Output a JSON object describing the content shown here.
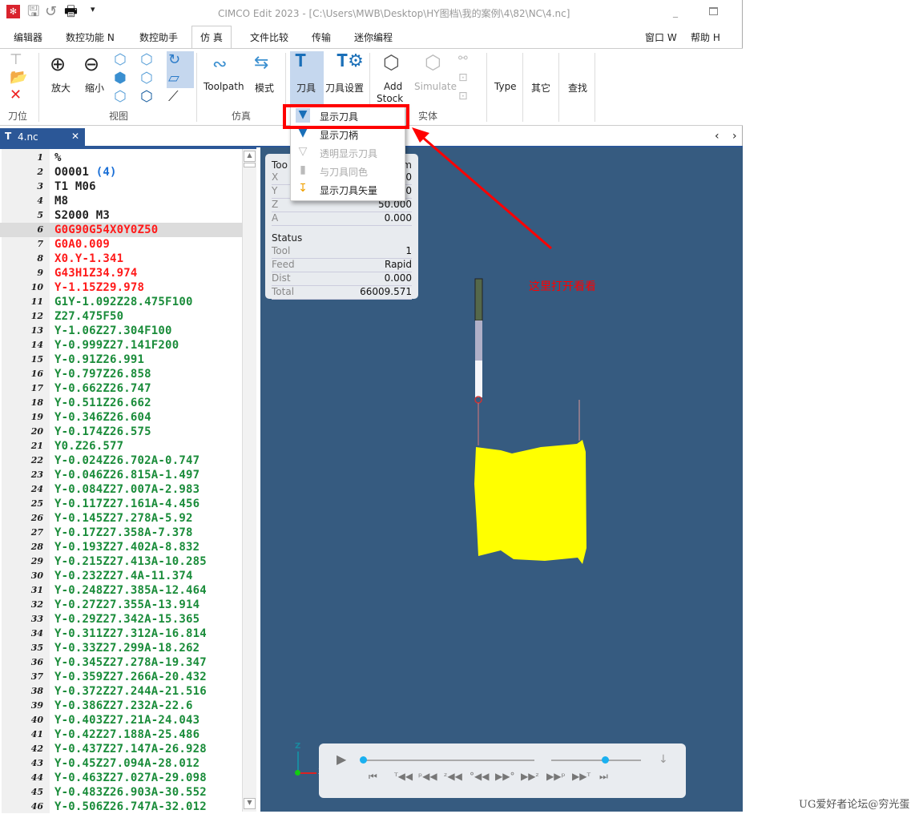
{
  "title": "CIMCO Edit 2023 - [C:\\Users\\MWB\\Desktop\\HY图档\\我的案例\\4\\82\\NC\\4.nc]",
  "menu_tabs": [
    "编辑器",
    "数控功能 N",
    "数控助手",
    "仿 真",
    "文件比较",
    "传输",
    "迷你编程"
  ],
  "menu_right": [
    "窗口 W",
    "帮助 H"
  ],
  "ribbon": {
    "groups": [
      "刀位",
      "视图",
      "仿真",
      "实体"
    ],
    "buttons": {
      "zoom_in": "放大",
      "zoom_out": "缩小",
      "toolpath": "Toolpath",
      "mode": "模式",
      "tool": "刀具",
      "tool_settings": "刀具设置",
      "add_stock_1": "Add",
      "add_stock_2": "Stock",
      "simulate": "Simulate",
      "type": "Type",
      "other": "其它",
      "find": "查找"
    }
  },
  "dropdown": {
    "items": [
      {
        "label": "显示刀具",
        "enabled": true,
        "selected": true
      },
      {
        "label": "显示刀柄",
        "enabled": true
      },
      {
        "label": "透明显示刀具",
        "enabled": false
      },
      {
        "label": "与刀具同色",
        "enabled": false
      },
      {
        "label": "显示刀具矢量",
        "enabled": true
      }
    ]
  },
  "doc_tab": {
    "label": "4.nc"
  },
  "code": [
    {
      "t": "%",
      "c": "black"
    },
    {
      "t": "O0001 ",
      "c": "black",
      "extra": "(4)"
    },
    {
      "t": "T1 M06",
      "c": "black"
    },
    {
      "t": "M8",
      "c": "black"
    },
    {
      "t": "S2000 M3",
      "c": "black"
    },
    {
      "t": "G0G90G54X0Y0Z50",
      "c": "red"
    },
    {
      "t": "G0A0.009",
      "c": "red"
    },
    {
      "t": "X0.Y-1.341",
      "c": "red"
    },
    {
      "t": "G43H1Z34.974",
      "c": "red"
    },
    {
      "t": "Y-1.15Z29.978",
      "c": "red"
    },
    {
      "t": "G1Y-1.092Z28.475F100",
      "c": "green"
    },
    {
      "t": "Z27.475F50",
      "c": "green"
    },
    {
      "t": "Y-1.06Z27.304F100",
      "c": "green"
    },
    {
      "t": "Y-0.999Z27.141F200",
      "c": "green"
    },
    {
      "t": "Y-0.91Z26.991",
      "c": "green"
    },
    {
      "t": "Y-0.797Z26.858",
      "c": "green"
    },
    {
      "t": "Y-0.662Z26.747",
      "c": "green"
    },
    {
      "t": "Y-0.511Z26.662",
      "c": "green"
    },
    {
      "t": "Y-0.346Z26.604",
      "c": "green"
    },
    {
      "t": "Y-0.174Z26.575",
      "c": "green"
    },
    {
      "t": "Y0.Z26.577",
      "c": "green"
    },
    {
      "t": "Y-0.024Z26.702A-0.747",
      "c": "green"
    },
    {
      "t": "Y-0.046Z26.815A-1.497",
      "c": "green"
    },
    {
      "t": "Y-0.084Z27.007A-2.983",
      "c": "green"
    },
    {
      "t": "Y-0.117Z27.161A-4.456",
      "c": "green"
    },
    {
      "t": "Y-0.145Z27.278A-5.92",
      "c": "green"
    },
    {
      "t": "Y-0.17Z27.358A-7.378",
      "c": "green"
    },
    {
      "t": "Y-0.193Z27.402A-8.832",
      "c": "green"
    },
    {
      "t": "Y-0.215Z27.413A-10.285",
      "c": "green"
    },
    {
      "t": "Y-0.232Z27.4A-11.374",
      "c": "green"
    },
    {
      "t": "Y-0.248Z27.385A-12.464",
      "c": "green"
    },
    {
      "t": "Y-0.27Z27.355A-13.914",
      "c": "green"
    },
    {
      "t": "Y-0.29Z27.342A-15.365",
      "c": "green"
    },
    {
      "t": "Y-0.311Z27.312A-16.814",
      "c": "green"
    },
    {
      "t": "Y-0.33Z27.299A-18.262",
      "c": "green"
    },
    {
      "t": "Y-0.345Z27.278A-19.347",
      "c": "green"
    },
    {
      "t": "Y-0.359Z27.266A-20.432",
      "c": "green"
    },
    {
      "t": "Y-0.372Z27.244A-21.516",
      "c": "green"
    },
    {
      "t": "Y-0.386Z27.232A-22.6",
      "c": "green"
    },
    {
      "t": "Y-0.403Z27.21A-24.043",
      "c": "green"
    },
    {
      "t": "Y-0.42Z27.188A-25.486",
      "c": "green"
    },
    {
      "t": "Y-0.437Z27.147A-26.928",
      "c": "green"
    },
    {
      "t": "Y-0.45Z27.094A-28.012",
      "c": "green"
    },
    {
      "t": "Y-0.463Z27.027A-29.098",
      "c": "green"
    },
    {
      "t": "Y-0.483Z26.903A-30.552",
      "c": "green"
    },
    {
      "t": "Y-0.506Z26.747A-32.012",
      "c": "green"
    }
  ],
  "highlight_line": 6,
  "colors": {
    "black": "#222222",
    "red": "#ff1a1a",
    "green": "#1a8c3a",
    "blue": "#1a6fd6",
    "viewport": "#365b80",
    "stock": "#ffff00",
    "annotation": "#ff0000"
  },
  "info": {
    "header_left": "Too",
    "header_right": "m",
    "coords": [
      {
        "k": "X",
        "v": "0"
      },
      {
        "k": "Y",
        "v": "0"
      },
      {
        "k": "Z",
        "v": "50.000"
      },
      {
        "k": "A",
        "v": "0.000"
      }
    ],
    "status_title": "Status",
    "status": [
      {
        "k": "Tool",
        "v": "1"
      },
      {
        "k": "Feed",
        "v": "Rapid"
      },
      {
        "k": "Dist",
        "v": "0.000"
      },
      {
        "k": "Total",
        "v": "66009.571"
      }
    ]
  },
  "annotation": "这里打开看看",
  "axes": {
    "z": "Z",
    "y": "Y",
    "x": "X"
  },
  "player": {
    "progress": 0,
    "speed": 0.6
  },
  "watermark": "UG爱好者论坛@穷光蛋"
}
